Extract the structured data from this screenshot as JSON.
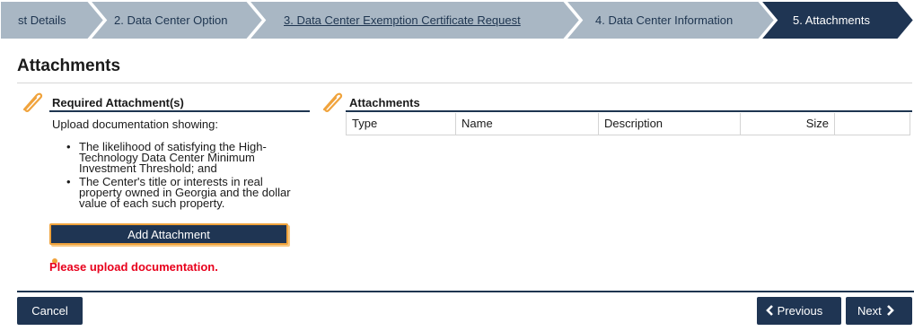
{
  "steps": [
    {
      "label": "st Details",
      "state": "done"
    },
    {
      "label": "2. Data Center Option",
      "state": "done"
    },
    {
      "label": "3. Data Center Exemption Certificate Request",
      "state": "link"
    },
    {
      "label": "4. Data Center Information",
      "state": "done"
    },
    {
      "label": "5. Attachments",
      "state": "active"
    }
  ],
  "page": {
    "title": "Attachments"
  },
  "required": {
    "header": "Required Attachment(s)",
    "intro": "Upload documentation showing:",
    "items": [
      "The likelihood of satisfying the High-Technology Data Center Minimum Investment Threshold; and",
      "The Center's title or interests in real property owned in Georgia and the dollar value of each such property."
    ],
    "add_button": "Add Attachment",
    "error": "Please upload documentation."
  },
  "attachments": {
    "header": "Attachments",
    "columns": [
      "Type",
      "Name",
      "Description",
      "Size",
      ""
    ]
  },
  "footer": {
    "cancel": "Cancel",
    "previous": "Previous",
    "next": "Next"
  },
  "colors": {
    "navy": "#1f3553",
    "step_inactive": "#a9b7c4",
    "accent_orange": "#f0a33c",
    "error_red": "#e8001c"
  },
  "icons": [
    "paperclip-icon",
    "chevron-left-icon",
    "chevron-right-icon"
  ]
}
